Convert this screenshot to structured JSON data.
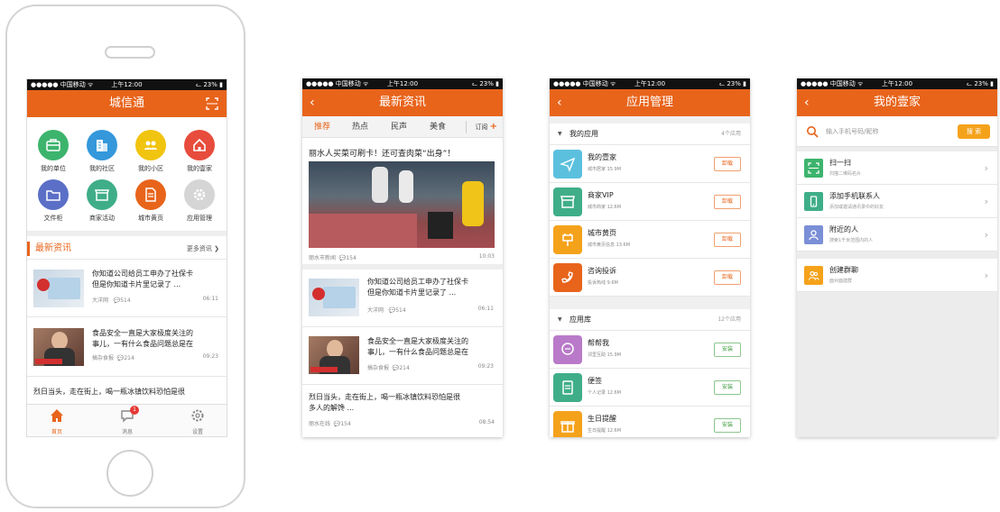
{
  "colors": {
    "accent": "#e8641b",
    "status_bar": "#111111"
  },
  "status_bar": {
    "carrier": "●●●●● 中国移动 ᯤ",
    "time": "上午12:00",
    "battery": "ᓚ 23% ▮"
  },
  "screen_home": {
    "title": "城信通",
    "grid": [
      {
        "label": "我的单位",
        "icon": "briefcase-icon",
        "color": "#3db46d"
      },
      {
        "label": "我的社区",
        "icon": "building-icon",
        "color": "#3498db"
      },
      {
        "label": "我的小区",
        "icon": "people-icon",
        "color": "#f1c40f"
      },
      {
        "label": "我的壹家",
        "icon": "home-icon",
        "color": "#e74c3c"
      },
      {
        "label": "文件柜",
        "icon": "folder-icon",
        "color": "#5b6fc7"
      },
      {
        "label": "商家活动",
        "icon": "shop-icon",
        "color": "#3fae88"
      },
      {
        "label": "城市黄页",
        "icon": "document-icon",
        "color": "#e8641b"
      },
      {
        "label": "应用管理",
        "icon": "gear-icon",
        "color": "#d5d5d5"
      }
    ],
    "news_heading": "最新资讯",
    "more": "更多资讯 ❯",
    "news": [
      {
        "line1": "你知道公司给员工申办了社保卡",
        "line2": "但是你知道卡片里记录了 ...",
        "source": "大洋网",
        "comments": "514",
        "time": "06:11"
      },
      {
        "line1": "食品安全一直是大家极度关注的",
        "line2": "事儿，一有什么食品问题总是在",
        "source": "搞杂食报",
        "comments": "214",
        "time": "09:23"
      },
      {
        "line1": "烈日当头，走在街上，喝一瓶冰镇饮料恐怕是很",
        "line2": "",
        "source": "",
        "comments": "",
        "time": ""
      }
    ],
    "tabs": [
      {
        "label": "首页",
        "icon": "home-icon"
      },
      {
        "label": "消息",
        "icon": "chat-icon",
        "badge": "1"
      },
      {
        "label": "设置",
        "icon": "gear-icon"
      }
    ]
  },
  "screen_news": {
    "title": "最新资讯",
    "back": "‹",
    "categories": [
      "推荐",
      "热点",
      "民声",
      "美食"
    ],
    "subscribe": "订阅",
    "subscribe_plus": "+",
    "headline": "丽水人买菜可刷卡！还可查肉菜“出身”！",
    "photo_meta": {
      "source": "丽水市新闻",
      "comments": "154",
      "time": "10:03"
    },
    "news": [
      {
        "line1": "你知道公司给员工申办了社保卡",
        "line2": "但是你知道卡片里记录了 ...",
        "source": "大洋网",
        "comments": "514",
        "time": "06:11"
      },
      {
        "line1": "食品安全一直是大家极度关注的",
        "line2": "事儿，一有什么食品问题总是在",
        "source": "搞杂食报",
        "comments": "214",
        "time": "09:23"
      },
      {
        "line1": "烈日当头，走在街上，喝一瓶冰镇饮料恐怕是很",
        "line2": "多人的解馋 ...",
        "source": "丽水在线",
        "comments": "154",
        "time": "08:54"
      }
    ]
  },
  "screen_apps": {
    "title": "应用管理",
    "back": "‹",
    "my_apps": {
      "label": "我的应用",
      "count": "4个应用"
    },
    "my_apps_list": [
      {
        "name": "我的壹家",
        "sub": "城市居家  15.9M",
        "button": "卸载",
        "color": "#5bc0de",
        "icon": "send-icon"
      },
      {
        "name": "商家VIP",
        "sub": "城市商家  12.6M",
        "button": "卸载",
        "color": "#3fae88",
        "icon": "shop-icon"
      },
      {
        "name": "城市黄页",
        "sub": "城市黄页信息  13.6M",
        "button": "卸载",
        "color": "#f5a21b",
        "icon": "plug-icon"
      },
      {
        "name": "咨询投诉",
        "sub": "投诉热线  9.6M",
        "button": "卸载",
        "color": "#e8641b",
        "icon": "phone-icon"
      }
    ],
    "library": {
      "label": "应用库",
      "count": "12个应用"
    },
    "library_list": [
      {
        "name": "帮帮我",
        "sub": "邻里互助  15.9M",
        "button": "安装",
        "color": "#b97ac9",
        "icon": "chat-icon"
      },
      {
        "name": "便签",
        "sub": "个人记录  12.6M",
        "button": "安装",
        "color": "#3fae88",
        "icon": "note-icon"
      },
      {
        "name": "生日提醒",
        "sub": "生日提醒  12.6M",
        "button": "安装",
        "color": "#f5a21b",
        "icon": "gift-icon"
      }
    ]
  },
  "screen_butler": {
    "title": "我的壹家",
    "back": "‹",
    "search_placeholder": "输入手机号码/昵称",
    "search_button": "搜 索",
    "rows": [
      {
        "name": "扫一扫",
        "sub": "扫描二维码名片",
        "color": "#3db46d",
        "icon": "scan-icon"
      },
      {
        "name": "添加手机联系人",
        "sub": "添加或邀请通讯录中的好友",
        "color": "#3fae88",
        "icon": "mobile-icon"
      },
      {
        "name": "附近的人",
        "sub": "搜索1千米范围内的人",
        "color": "#7b8fd6",
        "icon": "person-icon"
      }
    ],
    "group": {
      "name": "创建群聊",
      "sub": "面对面建群",
      "color": "#f5a21b",
      "icon": "group-icon"
    }
  }
}
